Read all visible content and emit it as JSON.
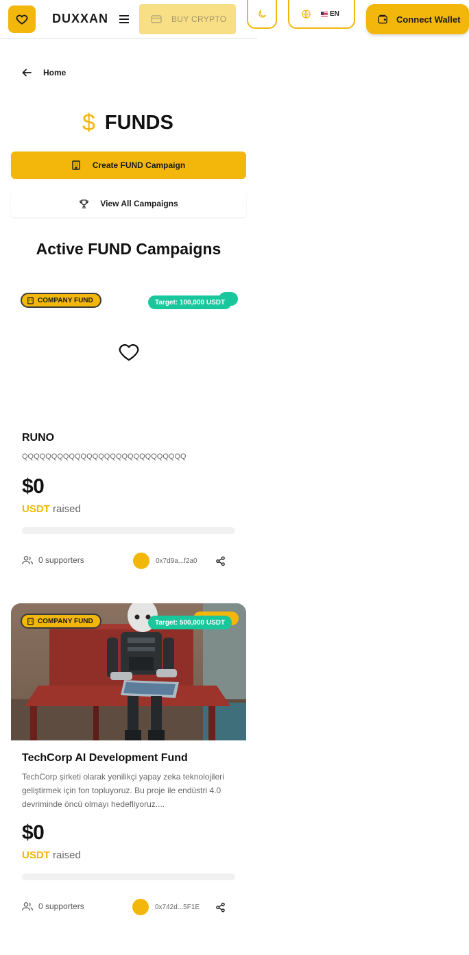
{
  "header": {
    "brand": "DUXXAN",
    "buy_crypto_label": "BUY CRYPTO",
    "language_label": "EN",
    "connect_wallet_label": "Connect Wallet"
  },
  "breadcrumb": {
    "home_label": "Home"
  },
  "page": {
    "title_symbol": "$",
    "title": "FUNDS",
    "create_button_label": "Create FUND Campaign",
    "view_all_button_label": "View All Campaigns",
    "section_title": "Active FUND Campaigns"
  },
  "colors": {
    "accent": "#f2b70a",
    "target_badge": "#18c79c",
    "text_primary": "#111111",
    "text_muted": "#666666"
  },
  "campaigns": [
    {
      "type_badge": "COMPANY FUND",
      "target_badge": "Target: 100,000 USDT",
      "name": "RUNO",
      "description": "QQQQQQQQQQQQQQQQQQQQQQQQQQQQ",
      "amount": "$0",
      "currency": "USDT",
      "raised_label": "raised",
      "progress": 0,
      "supporters": "0 supporters",
      "owner_address": "0x7d9a...f2a0",
      "has_image": false,
      "media_icon": "heart-icon"
    },
    {
      "type_badge": "COMPANY FUND",
      "target_badge": "Target: 500,000 USDT",
      "name": "TechCorp AI Development Fund",
      "description": "TechCorp şirketi olarak yenilikçi yapay zeka teknolojileri geliştirmek için fon topluyoruz. Bu proje ile endüstri 4.0 devriminde öncü olmayı hedefliyoruz....",
      "amount": "$0",
      "currency": "USDT",
      "raised_label": "raised",
      "progress": 0,
      "supporters": "0 supporters",
      "owner_address": "0x742d...5F1E",
      "has_image": true,
      "media_icon": "robot-photo"
    }
  ]
}
